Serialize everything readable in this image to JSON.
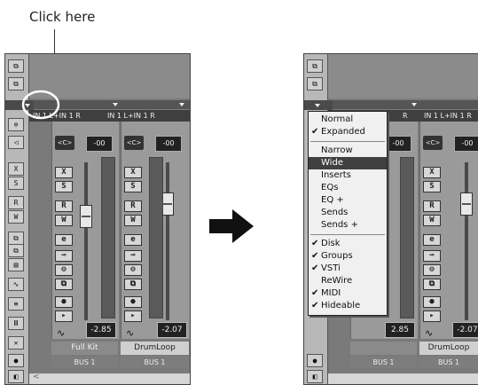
{
  "caption": "Click here",
  "arrow_icon": "right-arrow-icon",
  "left_panel": {
    "channels": [
      {
        "input": "IN 1 L+IN 1 R",
        "pan": "<C>",
        "volume": "-00",
        "level": "-2.85",
        "name": "Full Kit",
        "bus": "BUS 1",
        "selected": true
      },
      {
        "input": "IN 1 L+IN 1 R",
        "pan": "<C>",
        "volume": "-00",
        "level": "-2.07",
        "name": "DrumLoop",
        "bus": "BUS 1",
        "selected": false
      }
    ],
    "channel_buttons": [
      "X",
      "S",
      "R",
      "W",
      "e"
    ]
  },
  "right_panel": {
    "channels": [
      {
        "input": "R",
        "pan": "",
        "volume": "-00",
        "level": "2.85",
        "name": "",
        "bus": "BUS 1",
        "selected": true
      },
      {
        "input": "IN 1 L+IN 1 R",
        "pan": "<C>",
        "volume": "-00",
        "level": "-2.07",
        "name": "DrumLoop",
        "bus": "BUS 1",
        "selected": false
      }
    ],
    "menu": {
      "groups": [
        [
          {
            "label": "Normal",
            "checked": false,
            "highlighted": false
          },
          {
            "label": "Expanded",
            "checked": true,
            "highlighted": false
          }
        ],
        [
          {
            "label": "Narrow",
            "checked": false,
            "highlighted": false
          },
          {
            "label": "Wide",
            "checked": false,
            "highlighted": true
          },
          {
            "label": "Inserts",
            "checked": false,
            "highlighted": false
          },
          {
            "label": "EQs",
            "checked": false,
            "highlighted": false
          },
          {
            "label": "EQ +",
            "checked": false,
            "highlighted": false
          },
          {
            "label": "Sends",
            "checked": false,
            "highlighted": false
          },
          {
            "label": "Sends +",
            "checked": false,
            "highlighted": false
          }
        ],
        [
          {
            "label": "Disk",
            "checked": true,
            "highlighted": false
          },
          {
            "label": "Groups",
            "checked": true,
            "highlighted": false
          },
          {
            "label": "VSTi",
            "checked": true,
            "highlighted": false
          },
          {
            "label": "ReWire",
            "checked": false,
            "highlighted": false
          },
          {
            "label": "MIDI",
            "checked": true,
            "highlighted": false
          },
          {
            "label": "Hideable",
            "checked": true,
            "highlighted": false
          }
        ]
      ]
    }
  },
  "colors": {
    "highlight": "#404040",
    "circle": "#ffffff",
    "arrow": "#111111"
  }
}
